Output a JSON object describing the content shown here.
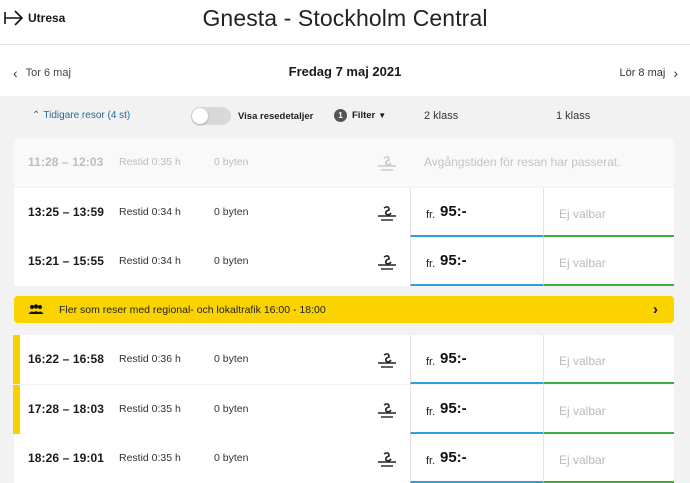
{
  "header": {
    "outbound_label": "Utresa",
    "route_title": "Gnesta - Stockholm Central"
  },
  "date_nav": {
    "prev_label": "Tor 6 maj",
    "current_label": "Fredag 7 maj 2021",
    "next_label": "Lör 8 maj"
  },
  "toolbar": {
    "earlier_trips_label": "Tidigare resor (4 st)",
    "details_toggle_label": "Visa resedetaljer",
    "details_toggle_on": false,
    "filter_count": "1",
    "filter_label": "Filter",
    "class2_label": "2 klass",
    "class1_label": "1 klass"
  },
  "past_trip": {
    "time": "11:28 – 12:03",
    "duration": "Restid 0:35 h",
    "changes": "0 byten",
    "message": "Avgångstiden för resan har passerat."
  },
  "trips_before_banner": [
    {
      "time": "13:25 – 13:59",
      "duration": "Restid 0:34 h",
      "changes": "0 byten",
      "price_prefix": "fr.",
      "price": "95:-",
      "first_class": "Ej valbar"
    },
    {
      "time": "15:21 – 15:55",
      "duration": "Restid 0:34 h",
      "changes": "0 byten",
      "price_prefix": "fr.",
      "price": "95:-",
      "first_class": "Ej valbar"
    }
  ],
  "banner": {
    "text": "Fler som reser med regional- och lokaltrafik 16:00 - 18:00"
  },
  "trips_after_banner": [
    {
      "time": "16:22 – 16:58",
      "duration": "Restid 0:36 h",
      "changes": "0 byten",
      "price_prefix": "fr.",
      "price": "95:-",
      "first_class": "Ej valbar",
      "busy": true
    },
    {
      "time": "17:28 – 18:03",
      "duration": "Restid 0:35 h",
      "changes": "0 byten",
      "price_prefix": "fr.",
      "price": "95:-",
      "first_class": "Ej valbar",
      "busy": true
    },
    {
      "time": "18:26 – 19:01",
      "duration": "Restid 0:35 h",
      "changes": "0 byten",
      "price_prefix": "fr.",
      "price": "95:-",
      "first_class": "Ej valbar",
      "busy": false
    }
  ],
  "colors": {
    "accent_yellow": "#fbd400",
    "second_class_underline": "#2f9fd8",
    "first_class_underline": "#3cae3c",
    "link_blue": "#2b6a90"
  },
  "icons": {
    "operator": "sj-train-icon",
    "crowd": "people-icon"
  }
}
